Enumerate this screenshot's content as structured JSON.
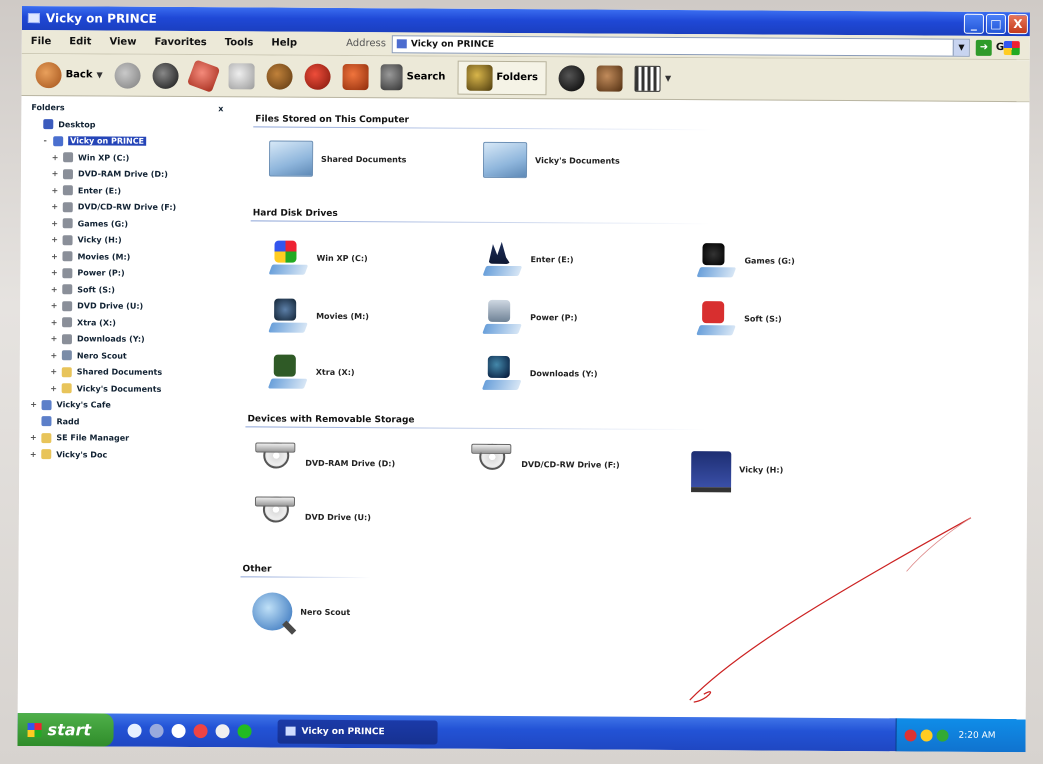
{
  "window": {
    "title": "Vicky on PRINCE",
    "buttons": {
      "minimize": "_",
      "maximize": "□",
      "close": "X"
    }
  },
  "menu": {
    "items": [
      "File",
      "Edit",
      "View",
      "Favorites",
      "Tools",
      "Help"
    ],
    "address_label": "Address",
    "address_value": "Vicky on PRINCE",
    "go_label": "Go"
  },
  "toolbar": {
    "back_label": "Back",
    "search_label": "Search",
    "folders_label": "Folders"
  },
  "folders_pane": {
    "title": "Folders",
    "close": "x",
    "items": [
      {
        "label": "Desktop",
        "exp": ""
      },
      {
        "label": "Vicky on PRINCE",
        "exp": "-"
      },
      {
        "label": "Win XP (C:)",
        "exp": "+"
      },
      {
        "label": "DVD-RAM Drive (D:)",
        "exp": "+"
      },
      {
        "label": "Enter (E:)",
        "exp": "+"
      },
      {
        "label": "DVD/CD-RW Drive (F:)",
        "exp": "+"
      },
      {
        "label": "Games (G:)",
        "exp": "+"
      },
      {
        "label": "Vicky (H:)",
        "exp": "+"
      },
      {
        "label": "Movies (M:)",
        "exp": "+"
      },
      {
        "label": "Power (P:)",
        "exp": "+"
      },
      {
        "label": "Soft (S:)",
        "exp": "+"
      },
      {
        "label": "DVD Drive (U:)",
        "exp": "+"
      },
      {
        "label": "Xtra (X:)",
        "exp": "+"
      },
      {
        "label": "Downloads (Y:)",
        "exp": "+"
      },
      {
        "label": "Nero Scout",
        "exp": "+"
      },
      {
        "label": "Shared Documents",
        "exp": "+"
      },
      {
        "label": "Vicky's Documents",
        "exp": "+"
      },
      {
        "label": "Vicky's Cafe",
        "exp": "+"
      },
      {
        "label": "Radd",
        "exp": ""
      },
      {
        "label": "SE File Manager",
        "exp": "+"
      },
      {
        "label": "Vicky's Doc",
        "exp": "+"
      }
    ]
  },
  "content": {
    "groups": {
      "stored": "Files Stored on This Computer",
      "hdd": "Hard Disk Drives",
      "removable": "Devices with Removable Storage",
      "other": "Other"
    },
    "stored_items": [
      "Shared Documents",
      "Vicky's Documents"
    ],
    "hdd_items": [
      "Win XP (C:)",
      "Enter (E:)",
      "Games (G:)",
      "Movies (M:)",
      "Power (P:)",
      "Soft (S:)",
      "Xtra (X:)",
      "Downloads (Y:)"
    ],
    "removable_items": [
      "DVD-RAM Drive (D:)",
      "DVD/CD-RW Drive (F:)",
      "Vicky (H:)",
      "DVD Drive (U:)"
    ],
    "other_items": [
      "Nero Scout"
    ]
  },
  "taskbar": {
    "start_label": "start",
    "task_button": "Vicky on PRINCE",
    "clock": "2:20 AM"
  },
  "colors": {
    "titlebar": "#1f48d6",
    "taskbar": "#2353d6",
    "start": "#2f8c2a",
    "selection": "#2545b8"
  }
}
